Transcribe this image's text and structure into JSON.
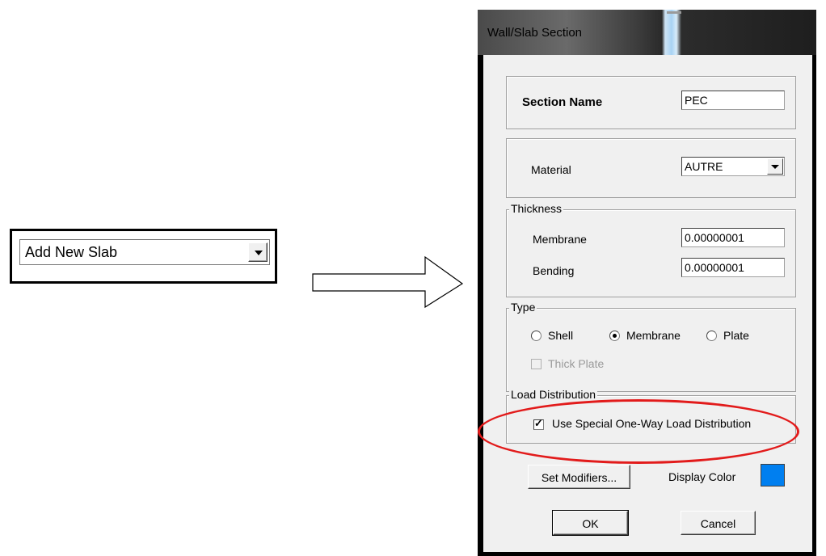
{
  "left_combo": {
    "value": "Add New Slab"
  },
  "dialog": {
    "title": "Wall/Slab Section",
    "section_name": {
      "label": "Section Name",
      "value": "PEC"
    },
    "material": {
      "label": "Material",
      "value": "AUTRE"
    },
    "thickness": {
      "legend": "Thickness",
      "membrane": {
        "label": "Membrane",
        "value": "0.00000001"
      },
      "bending": {
        "label": "Bending",
        "value": "0.00000001"
      }
    },
    "type": {
      "legend": "Type",
      "options": [
        {
          "label": "Shell",
          "selected": false
        },
        {
          "label": "Membrane",
          "selected": true
        },
        {
          "label": "Plate",
          "selected": false
        }
      ],
      "thick_plate": {
        "label": "Thick Plate",
        "checked": false,
        "enabled": false
      }
    },
    "load_distribution": {
      "legend": "Load Distribution",
      "one_way": {
        "label": "Use Special One-Way Load Distribution",
        "checked": true
      }
    },
    "set_modifiers_label": "Set Modifiers...",
    "display_color": {
      "label": "Display Color",
      "color": "#007ff0"
    },
    "ok_label": "OK",
    "cancel_label": "Cancel"
  },
  "annotation": {
    "arrow_color": "#000000",
    "highlight_color": "#e21b1b"
  }
}
